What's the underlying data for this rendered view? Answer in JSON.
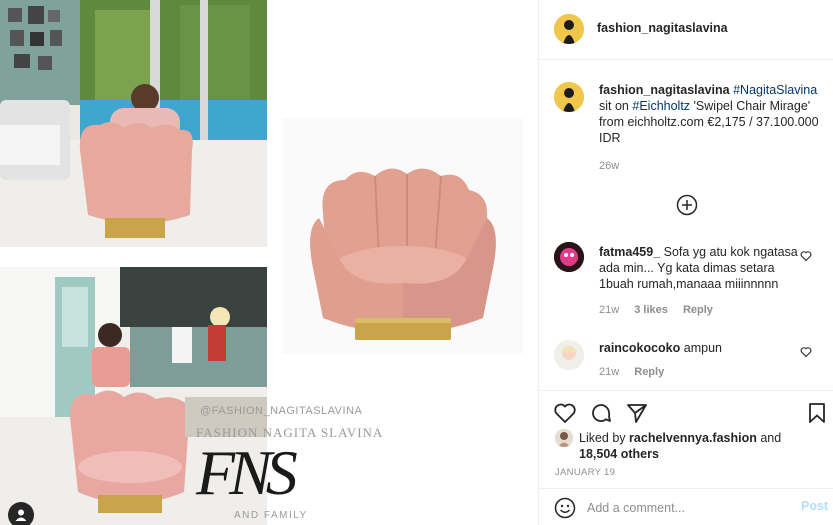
{
  "watermark": {
    "handle": "@FASHION_NAGITASLAVINA",
    "name": "FASHION NAGITA SLAVINA",
    "monogram": "FNS",
    "family": "AND FAMILY"
  },
  "header": {
    "username": "fashion_nagitaslavina",
    "avatar_color": "#f0c74a"
  },
  "caption": {
    "username": "fashion_nagitaslavina",
    "hashtag1": "#NagitaSlavina",
    "text1": "sit on",
    "hashtag2": "#Eichholtz",
    "text2": "'Swipel Chair Mirage' from eichholtz.com €2,175 / 37.100.000 IDR",
    "time": "26w"
  },
  "comments": [
    {
      "username": "fatma459_",
      "text": "Sofa yg atu kok ngatasa ada min... Yg kata dimas setara 1buah rumah,manaaa miiinnnnn",
      "time": "21w",
      "likes": "3 likes",
      "reply": "Reply"
    },
    {
      "username": "raincokocoko",
      "text": "ampun",
      "time": "21w",
      "reply": "Reply"
    }
  ],
  "likes": {
    "prefix": "Liked by",
    "user": "rachelvennya.fashion",
    "middle": "and",
    "count": "18,504 others"
  },
  "date": "JANUARY 19",
  "add_comment": {
    "placeholder": "Add a comment...",
    "post_label": "Post"
  },
  "colors": {
    "link": "#00376b",
    "meta": "#8e8e8e",
    "post_disabled": "#b2dffc",
    "chair_pink": "#e9a99a",
    "chair_gold": "#c9a44a"
  },
  "icons": [
    "user-tag-icon",
    "plus-circle-icon",
    "heart-icon",
    "comment-icon",
    "share-icon",
    "bookmark-icon",
    "emoji-icon"
  ]
}
